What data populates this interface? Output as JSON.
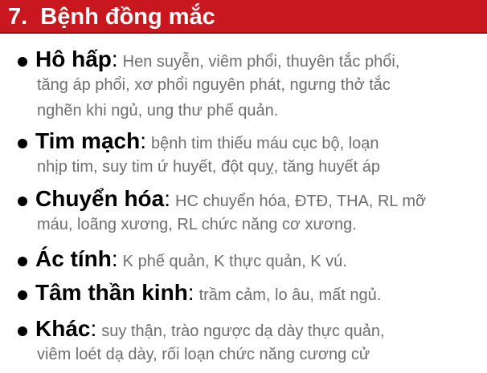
{
  "title": "7.  Bệnh đồng mắc",
  "items": [
    {
      "term": "Hô hấp",
      "colon": ":",
      "lines": [
        "Hen suyễn, viêm phổi, thuyên tắc phổi,",
        "tăng áp phổi, xơ phổi nguyên phát, ngưng thở tắc",
        "nghẽn khi ngủ, ung thư phế quản."
      ]
    },
    {
      "term": "Tim mạch",
      "colon": ":",
      "lines": [
        "bệnh tim thiếu máu cục bộ, loạn",
        "nhịp tim, suy tim ứ huyết, đột quỵ, tăng huyết áp"
      ]
    },
    {
      "term": "Chuyển hóa",
      "colon": ":",
      "lines": [
        "HC chuyển hóa, ĐTĐ, THA, RL mỡ",
        "máu, loãng xương, RL chức năng cơ xương."
      ]
    },
    {
      "term": "Ác tính",
      "colon": ":",
      "lines": [
        "K phế quản, K thực quản, K vú."
      ]
    },
    {
      "term": "Tâm thần kinh",
      "colon": ":",
      "lines": [
        "trầm cảm, lo âu, mất ngủ."
      ]
    },
    {
      "term": "Khác",
      "colon": ":",
      "lines": [
        "suy thận, trào ngược dạ dày thực quản,",
        "viêm loét dạ dày, rối loạn chức năng cương cử"
      ]
    }
  ]
}
